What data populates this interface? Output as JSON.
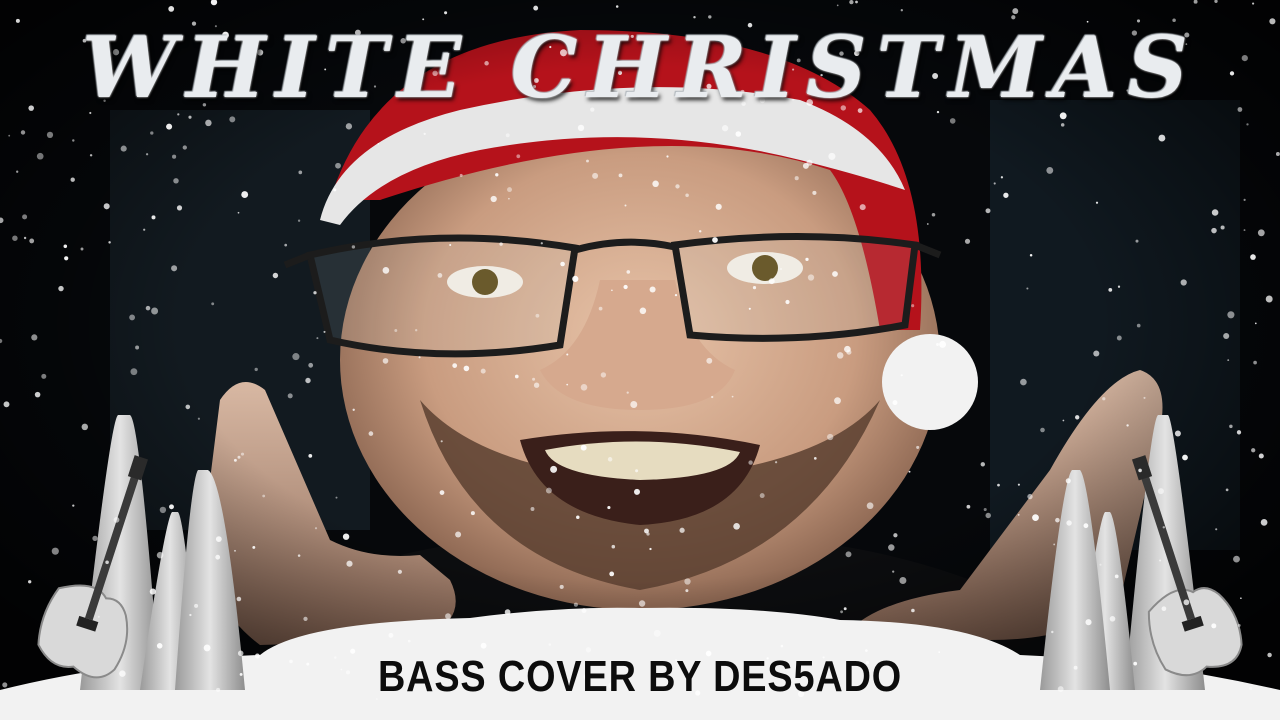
{
  "title": "WHITE CHRISTMAS",
  "subtitle": "BASS COVER BY DES5ADO",
  "icons": [
    "bass-guitar-icon",
    "snow-cone-tree-icon",
    "santa-hat",
    "glasses"
  ],
  "colors": {
    "background": "#05070a",
    "title": "#e9ecef",
    "subtitle": "#0c0c0c",
    "snow": "#f2f2f2",
    "hat_red": "#b5121b"
  }
}
